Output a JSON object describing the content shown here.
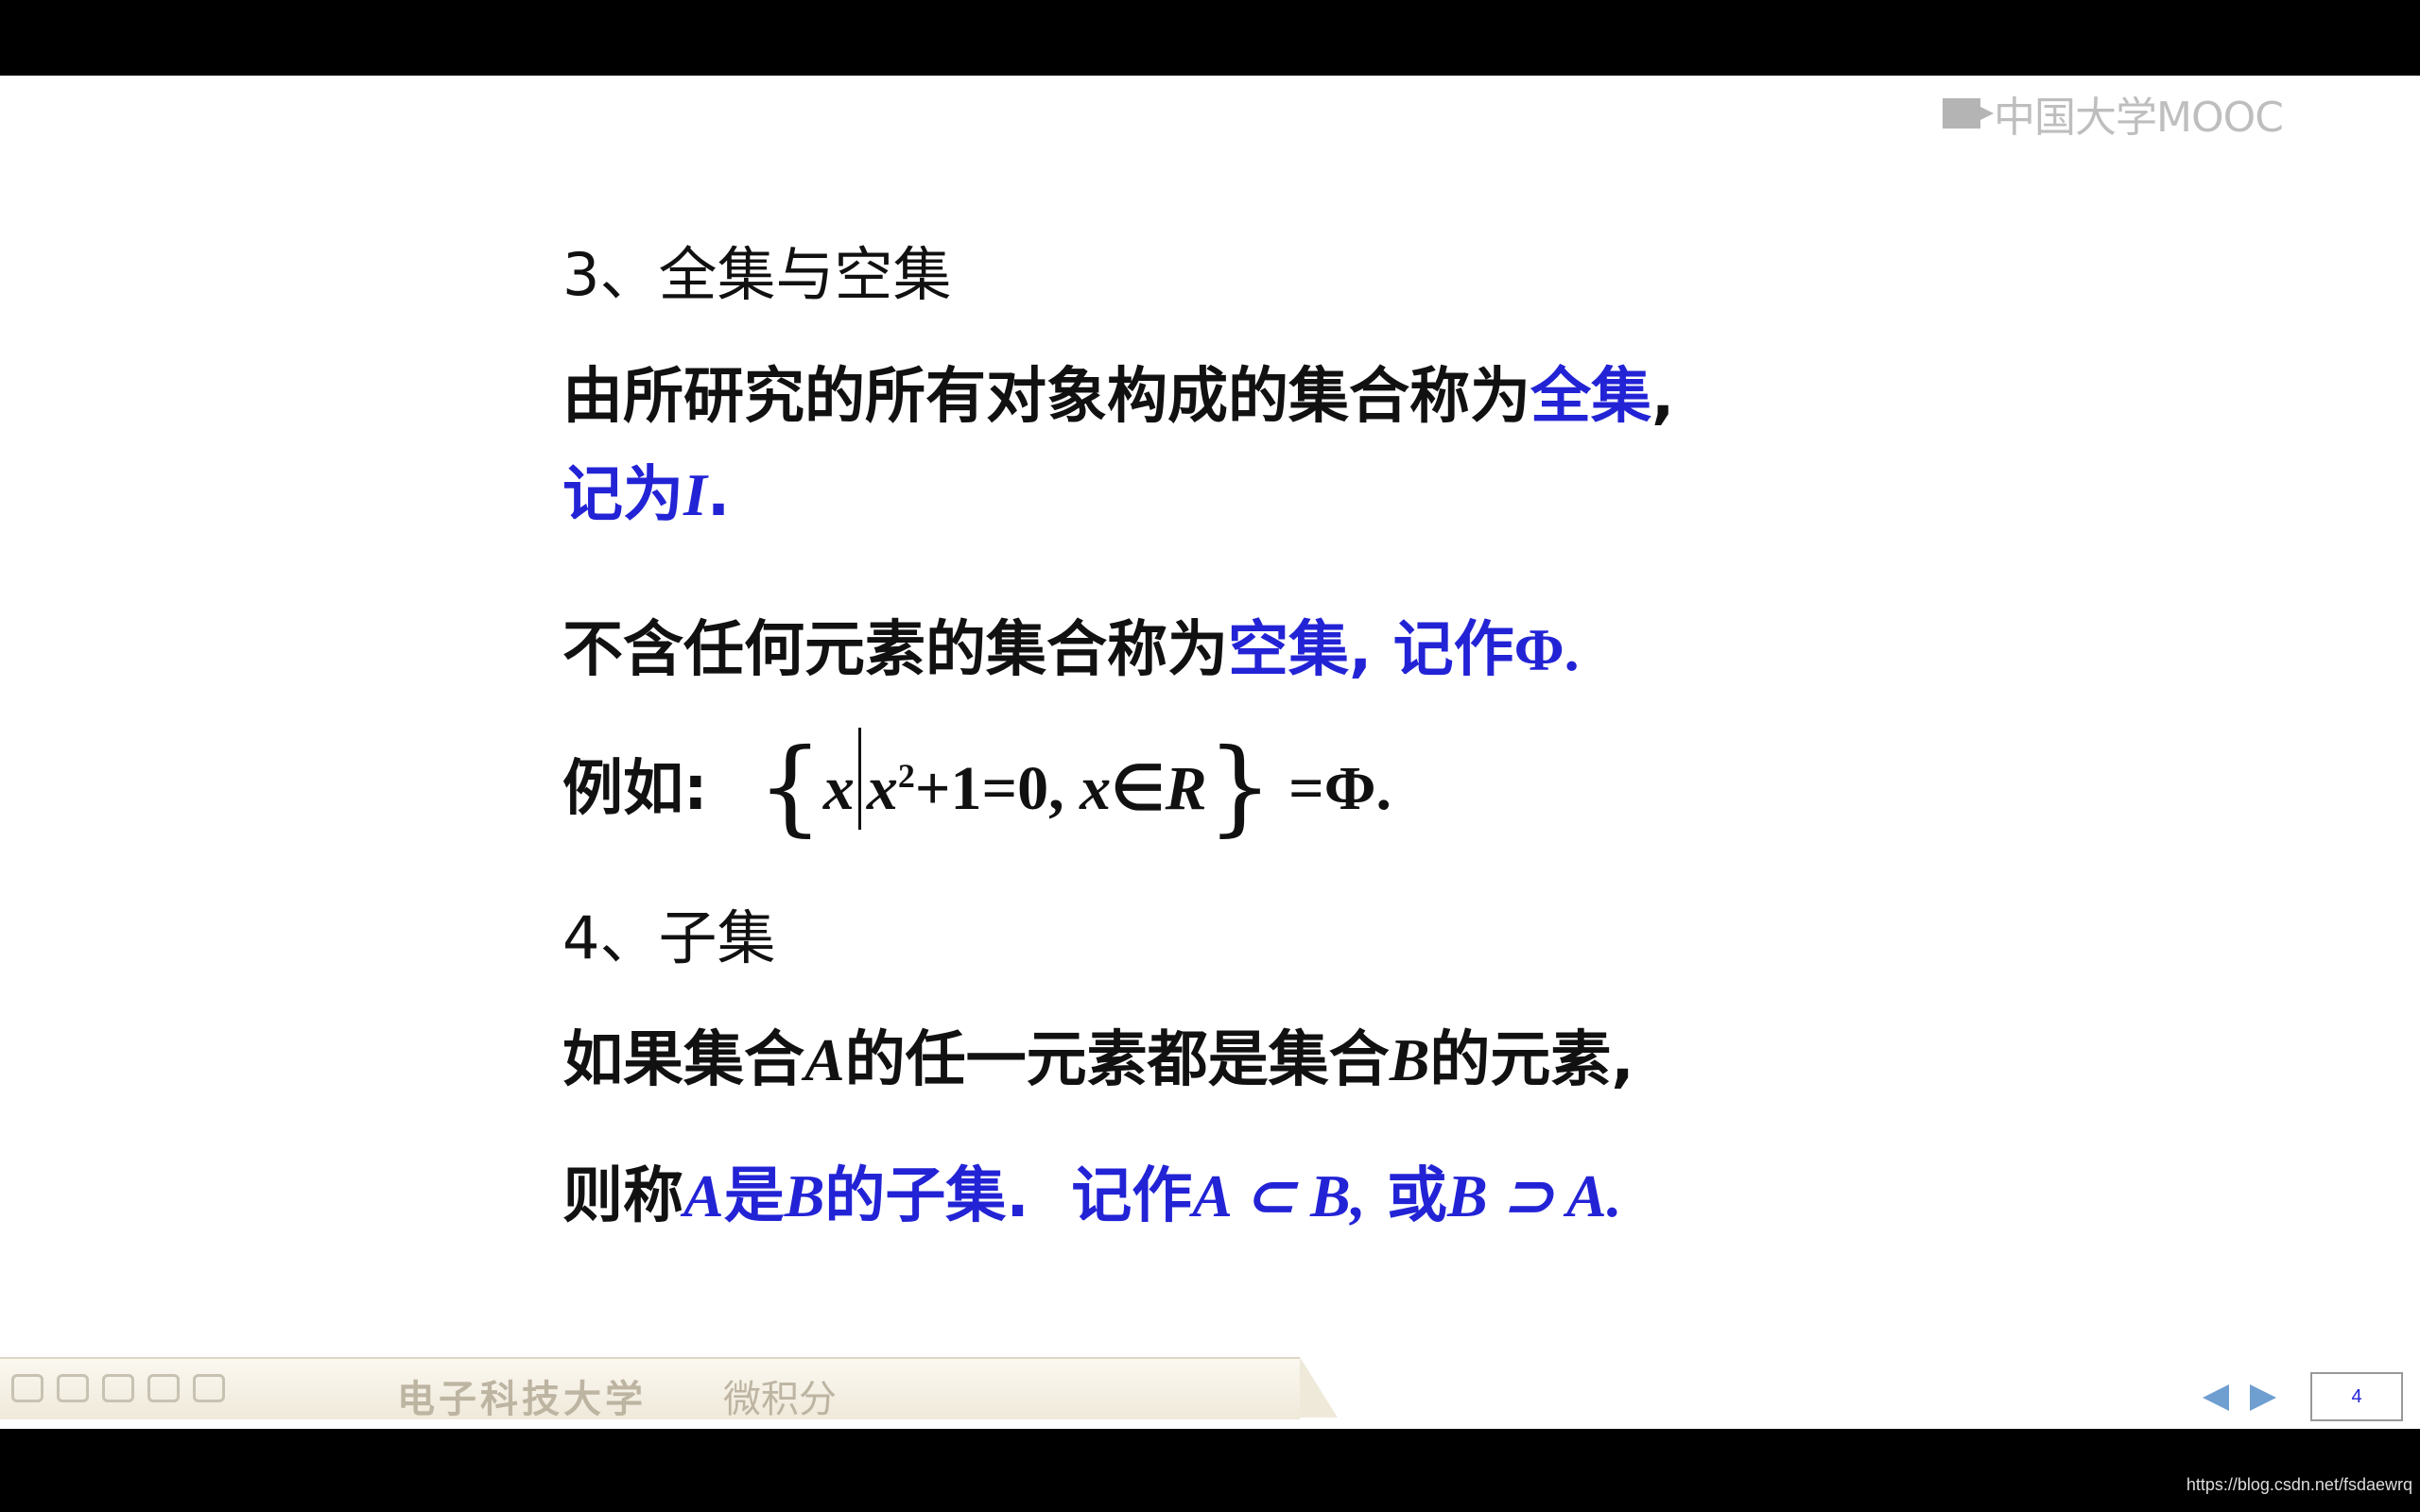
{
  "watermark": {
    "text": "中国大学MOOC"
  },
  "slide": {
    "section3_heading": "3、全集与空集",
    "universal_line1_prefix": "由所研究的所有对象构成的集合称为",
    "universal_term": "全集",
    "universal_line1_comma": ",",
    "universal_line2_label": "记为",
    "universal_symbol": "I",
    "universal_period": ".",
    "empty_prefix": "不含任何元素的集合称为",
    "empty_term": "空集,",
    "empty_notation_label": "记作",
    "empty_symbol": "Φ.",
    "example_label": "例如:",
    "example_var": "x",
    "example_expr_x": "x",
    "example_exp": "2",
    "example_rest": "+1=0,",
    "example_x2": "x",
    "example_in": "∈",
    "example_R": "R",
    "example_result": "=Φ.",
    "section4_heading": "4、子集",
    "subset_l1_a": "如果集合",
    "subset_l1_A": "A",
    "subset_l1_b": "的任一元素都是集合",
    "subset_l1_B": "B",
    "subset_l1_c": "的元素,",
    "subset_l2_a": "则称",
    "subset_l2_A": "A",
    "subset_l2_is": "是",
    "subset_l2_B": "B",
    "subset_l2_sub": "的子集.",
    "subset_l2_note": "记作",
    "subset_l2_rel1": "A ⊂ B,",
    "subset_l2_or": "或",
    "subset_l2_rel2": "B ⊃ A."
  },
  "toolbar": {
    "university": "电子科技大学",
    "course": "微积分",
    "page_number": "4"
  },
  "url": "https://blog.csdn.net/fsdaewrq"
}
